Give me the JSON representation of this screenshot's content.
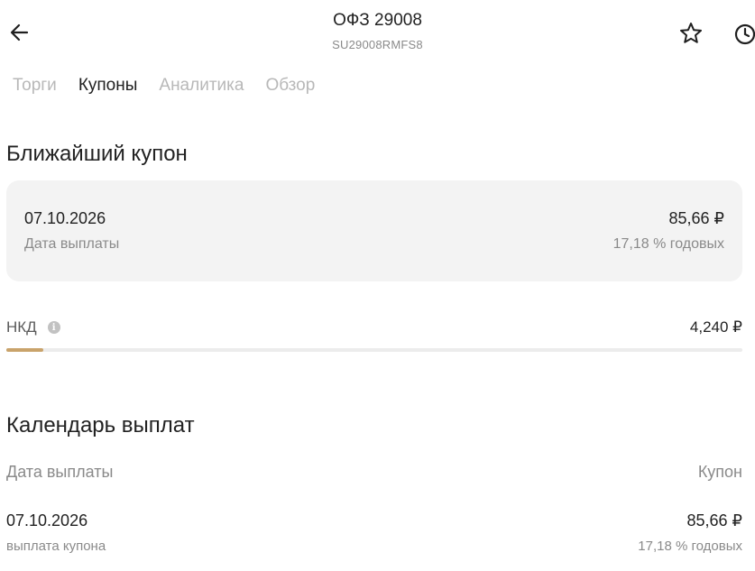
{
  "header": {
    "title": "ОФЗ 29008",
    "subtitle": "SU29008RMFS8"
  },
  "icons": {
    "back": "arrow-left-icon",
    "favorite": "star-icon",
    "history": "clock-icon",
    "info": "info-icon"
  },
  "tabs": [
    {
      "label": "Торги",
      "active": false
    },
    {
      "label": "Купоны",
      "active": true
    },
    {
      "label": "Аналитика",
      "active": false
    },
    {
      "label": "Обзор",
      "active": false
    }
  ],
  "nearest_coupon": {
    "heading": "Ближайший купон",
    "date": "07.10.2026",
    "date_label": "Дата выплаты",
    "amount": "85,66 ₽",
    "rate": "17,18 % годовых"
  },
  "nkd": {
    "label": "НКД",
    "value": "4,240 ₽",
    "progress_fraction": 0.05,
    "progress_color": "#c9a36b"
  },
  "calendar": {
    "heading": "Календарь выплат",
    "col_date": "Дата выплаты",
    "col_coupon": "Купон",
    "rows": [
      {
        "date": "07.10.2026",
        "type": "выплата купона",
        "amount": "85,66 ₽",
        "rate": "17,18 % годовых"
      }
    ]
  }
}
